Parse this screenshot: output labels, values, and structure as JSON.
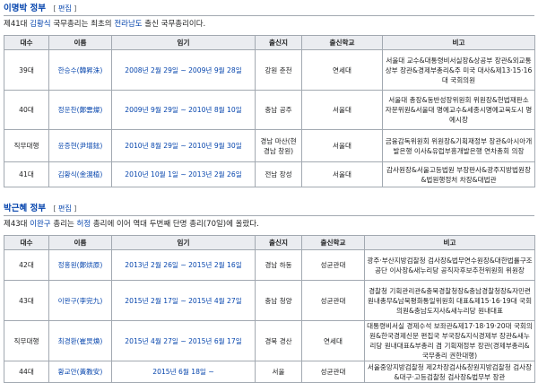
{
  "section1": {
    "title": "이명박 정부",
    "edit_label": "편집",
    "intro_parts": [
      "제41대 ",
      "김황식",
      " 국무총리는 최초의 ",
      "전라남도",
      " 출신 국무총리이다."
    ],
    "headers": [
      "대수",
      "이름",
      "임기",
      "출신지",
      "출신학교",
      "비고"
    ],
    "rows": [
      {
        "num": "39대",
        "name": "한승수(韓昇洙)",
        "term": "2008년 2월 29일 ~ 2009년 9월 28일",
        "origin": "강원 춘천",
        "school": "연세대",
        "note": "서울대 교수&대통령비서실장&상공부 장관&외교통상부 장관&경제부총리&주 미국 대사&제13·15·16대 국회의원"
      },
      {
        "num": "40대",
        "name": "정운찬(鄭雲燦)",
        "term": "2009년 9월 29일 ~ 2010년 8월 10일",
        "origin": "충남 공주",
        "school": "서울대",
        "note": "서울대 총장&동반성장위원회 위원장&헌법재판소 자문위원&서울대 명예교수&세종시명예교육도시 명예시장"
      },
      {
        "num": "직무대행",
        "name": "윤증현(尹增鉉)",
        "term": "2010년 8월 29일 ~ 2010년 9월 30일",
        "origin": "경남 마산(현 경남 창원)",
        "school": "서울대",
        "note": "금융감독위원회 위원장&기획재정부 장관&아시아개발은행 이사&유럽부흥개발은행 연차총회 의장"
      },
      {
        "num": "41대",
        "name": "김황식(金滉植)",
        "term": "2010년 10월 1일 ~ 2013년 2월 26일",
        "origin": "전남 장성",
        "school": "서울대",
        "note": "감사원장&서울고등법원 부장판사&광주지방법원장&법원행정처 차장&대법관"
      }
    ]
  },
  "section2": {
    "title": "박근혜 정부",
    "edit_label": "편집",
    "intro_parts": [
      "제43대 ",
      "이완구",
      " 총리는 ",
      "허정",
      " 총리에 이어 역대 두번째 단명 총리(70일)에 올랐다."
    ],
    "headers": [
      "대수",
      "이름",
      "임기",
      "출신지",
      "출신학교",
      "비고"
    ],
    "rows": [
      {
        "num": "42대",
        "name": "정홍원(鄭烘原)",
        "term": "2013년 2월 26일 ~ 2015년 2월 16일",
        "origin": "경남 하동",
        "school": "성균관대",
        "note": "광주·부산지방검찰청 검사장&법무연수원장&대한법률구조공단 이사장&새누리당 공직자후보추천위원회 위원장"
      },
      {
        "num": "43대",
        "name": "이완구(李完九)",
        "term": "2015년 2월 17일 ~ 2015년 4월 27일",
        "origin": "충남 청양",
        "school": "성균관대",
        "note": "경찰청 기획관리관&충북경찰청장&충남경찰청장&자민련 원내총무&남북평화통일위원회 대표&제15·16·19대 국회의원&충남도지사&새누리당 원내대표"
      },
      {
        "num": "직무대행",
        "name": "최경환(崔炅煥)",
        "term": "2015년 4월 27일 ~ 2015년 6월 17일",
        "origin": "경북 경산",
        "school": "연세대",
        "note": "대통령비서실 경제수석 보좌관&제17·18·19·20대 국회의원&한국경제신문 편집국 부국장&지식경제부 장관&새누리당 원내대표&부총리 겸 기획재정부 장관(경제부총리&국무총리 권한대행)"
      },
      {
        "num": "44대",
        "name": "황교안(黃教安)",
        "term": "2015년 6월 18일 ~",
        "origin": "서울",
        "school": "성균관대",
        "note": "서울중앙지방검찰청 제2차장검사&창원지방검찰청 검사장&대구·고등검찰청 검사장&법무부 장관"
      }
    ]
  }
}
